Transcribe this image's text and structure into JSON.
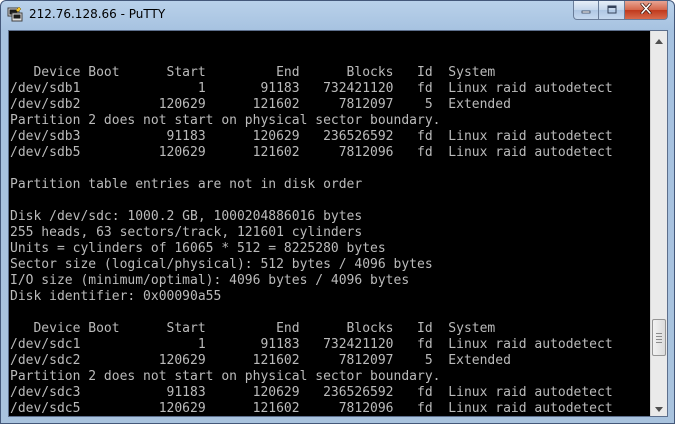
{
  "window": {
    "title": "212.76.128.66 - PuTTY"
  },
  "icons": {
    "app": "putty-icon",
    "minimize": "minimize-icon",
    "maximize": "maximize-icon",
    "close": "close-icon",
    "scroll_up": "scroll-up-arrow-icon",
    "scroll_down": "scroll-down-arrow-icon"
  },
  "colors": {
    "terminal_background": "#000000",
    "terminal_text": "#bbbbbb",
    "close_button": "#c7432a"
  },
  "terminal": {
    "lines": [
      "",
      "   Device Boot      Start         End      Blocks   Id  System",
      "/dev/sdb1               1       91183   732421120   fd  Linux raid autodetect",
      "/dev/sdb2          120629      121602     7812097    5  Extended",
      "Partition 2 does not start on physical sector boundary.",
      "/dev/sdb3           91183      120629   236526592   fd  Linux raid autodetect",
      "/dev/sdb5          120629      121602     7812096   fd  Linux raid autodetect",
      "",
      "Partition table entries are not in disk order",
      "",
      "Disk /dev/sdc: 1000.2 GB, 1000204886016 bytes",
      "255 heads, 63 sectors/track, 121601 cylinders",
      "Units = cylinders of 16065 * 512 = 8225280 bytes",
      "Sector size (logical/physical): 512 bytes / 4096 bytes",
      "I/O size (minimum/optimal): 4096 bytes / 4096 bytes",
      "Disk identifier: 0x00090a55",
      "",
      "   Device Boot      Start         End      Blocks   Id  System",
      "/dev/sdc1               1       91183   732421120   fd  Linux raid autodetect",
      "/dev/sdc2          120629      121602     7812097    5  Extended",
      "Partition 2 does not start on physical sector boundary.",
      "/dev/sdc3           91183      120629   236526592   fd  Linux raid autodetect",
      "/dev/sdc5          120629      121602     7812096   fd  Linux raid autodetect",
      ""
    ]
  }
}
